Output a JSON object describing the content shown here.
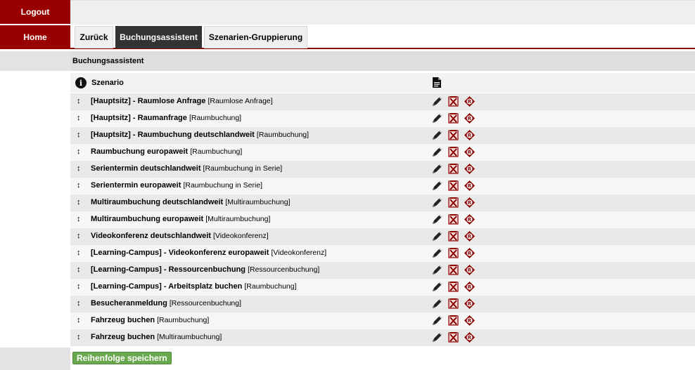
{
  "sidebar": {
    "logout": "Logout",
    "home": "Home"
  },
  "tabs": [
    {
      "label": "Zurück",
      "active": false
    },
    {
      "label": "Buchungsassistent",
      "active": true
    },
    {
      "label": "Szenarien-Gruppierung",
      "active": false
    }
  ],
  "section_title": "Buchungsassistent",
  "table": {
    "header_label": "Szenario",
    "info_icon": "info-icon",
    "header_icon": "document-icon",
    "row_actions": [
      "edit-pencil-icon",
      "delete-icon",
      "r-badge-icon"
    ],
    "rows": [
      {
        "name": "[Hauptsitz] - Raumlose Anfrage",
        "type": "[Raumlose Anfrage]"
      },
      {
        "name": "[Hauptsitz] - Raumanfrage",
        "type": "[Raumbuchung]"
      },
      {
        "name": "[Hauptsitz] - Raumbuchung deutschlandweit",
        "type": "[Raumbuchung]"
      },
      {
        "name": "Raumbuchung europaweit",
        "type": "[Raumbuchung]"
      },
      {
        "name": "Serientermin deutschlandweit",
        "type": "[Raumbuchung in Serie]"
      },
      {
        "name": "Serientermin europaweit",
        "type": "[Raumbuchung in Serie]"
      },
      {
        "name": "Multiraumbuchung deutschlandweit",
        "type": "[Multiraumbuchung]"
      },
      {
        "name": "Multiraumbuchung europaweit",
        "type": "[Multiraumbuchung]"
      },
      {
        "name": "Videokonferenz deutschlandweit",
        "type": "[Videokonferenz]"
      },
      {
        "name": "[Learning-Campus] - Videokonferenz europaweit",
        "type": "[Videokonferenz]"
      },
      {
        "name": "[Learning-Campus] - Ressourcenbuchung",
        "type": "[Ressourcenbuchung]"
      },
      {
        "name": "[Learning-Campus] - Arbeitsplatz buchen",
        "type": "[Raumbuchung]"
      },
      {
        "name": "Besucheranmeldung",
        "type": "[Ressourcenbuchung]"
      },
      {
        "name": "Fahrzeug buchen",
        "type": "[Raumbuchung]"
      },
      {
        "name": "Fahrzeug buchen",
        "type": "[Multiraumbuchung]"
      }
    ]
  },
  "footer": {
    "save_label": "Reihenfolge speichern"
  },
  "colors": {
    "brand": "#990000",
    "active_tab": "#333333",
    "save_button": "#6aa84f"
  }
}
